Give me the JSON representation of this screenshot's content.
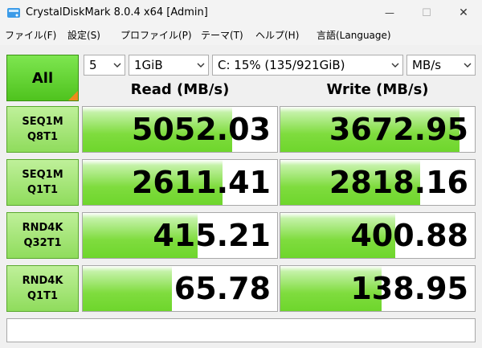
{
  "window": {
    "title": "CrystalDiskMark 8.0.4 x64 [Admin]",
    "minimize_glyph": "—",
    "maximize_glyph": "☐",
    "close_glyph": "✕"
  },
  "menu": [
    {
      "label": "ファイル(F)"
    },
    {
      "label": "設定(S)"
    },
    {
      "label": "プロファイル(P)"
    },
    {
      "label": "テーマ(T)"
    },
    {
      "label": "ヘルプ(H)"
    },
    {
      "label": "言語(Language)"
    }
  ],
  "controls": {
    "all_label": "All",
    "count": "5",
    "size": "1GiB",
    "drive": "C: 15% (135/921GiB)",
    "unit": "MB/s"
  },
  "headers": {
    "read": "Read (MB/s)",
    "write": "Write (MB/s)"
  },
  "rows": [
    {
      "line1": "SEQ1M",
      "line2": "Q8T1",
      "read": "5052.03",
      "write": "3672.95",
      "read_fill": 0.77,
      "write_fill": 0.92
    },
    {
      "line1": "SEQ1M",
      "line2": "Q1T1",
      "read": "2611.41",
      "write": "2818.16",
      "read_fill": 0.72,
      "write_fill": 0.72
    },
    {
      "line1": "RND4K",
      "line2": "Q32T1",
      "read": "415.21",
      "write": "400.88",
      "read_fill": 0.59,
      "write_fill": 0.59
    },
    {
      "line1": "RND4K",
      "line2": "Q1T1",
      "read": "65.78",
      "write": "138.95",
      "read_fill": 0.46,
      "write_fill": 0.52
    }
  ],
  "comment": "",
  "colors": {
    "accent_green": "#6ed62c",
    "corner_orange": "#f08a1c"
  },
  "icons": {
    "app": "crystaldiskmark-disk-icon",
    "dropdown": "chevron-down-icon"
  }
}
